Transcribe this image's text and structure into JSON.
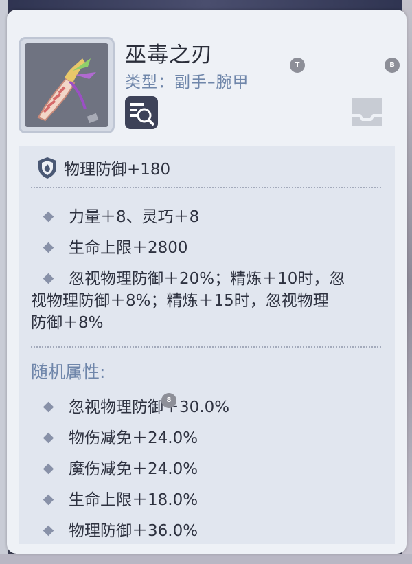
{
  "item": {
    "name": "巫毒之刃",
    "type": "类型：副手–腕甲",
    "base_stat": "物理防御+180"
  },
  "hints": {
    "t": "T",
    "b": "B",
    "n": "8"
  },
  "stats": [
    "力量＋8、灵巧＋8",
    "生命上限＋2800"
  ],
  "special_line1": "忽视物理防御＋20%；精炼＋10时，忽",
  "special_line2": "视物理防御＋8%；精炼＋15时，忽视物理",
  "special_line3": "防御＋8%",
  "random_label": "随机属性:",
  "random_stats": [
    "忽视物理防御＋30.0%",
    "物伤减免＋24.0%",
    "魔伤减免＋24.0%",
    "生命上限＋18.0%",
    "物理防御＋36.0%"
  ],
  "icons": {
    "item": "vodoo-blade-icon",
    "inspect": "inspect-magnifier-icon",
    "slot": "equipment-slot-icon",
    "defense": "shield-icon",
    "bullet": "diamond-bullet-icon"
  },
  "colors": {
    "accent": "#6f86aa",
    "text": "#2e3240",
    "panel": "#eef1f6"
  }
}
